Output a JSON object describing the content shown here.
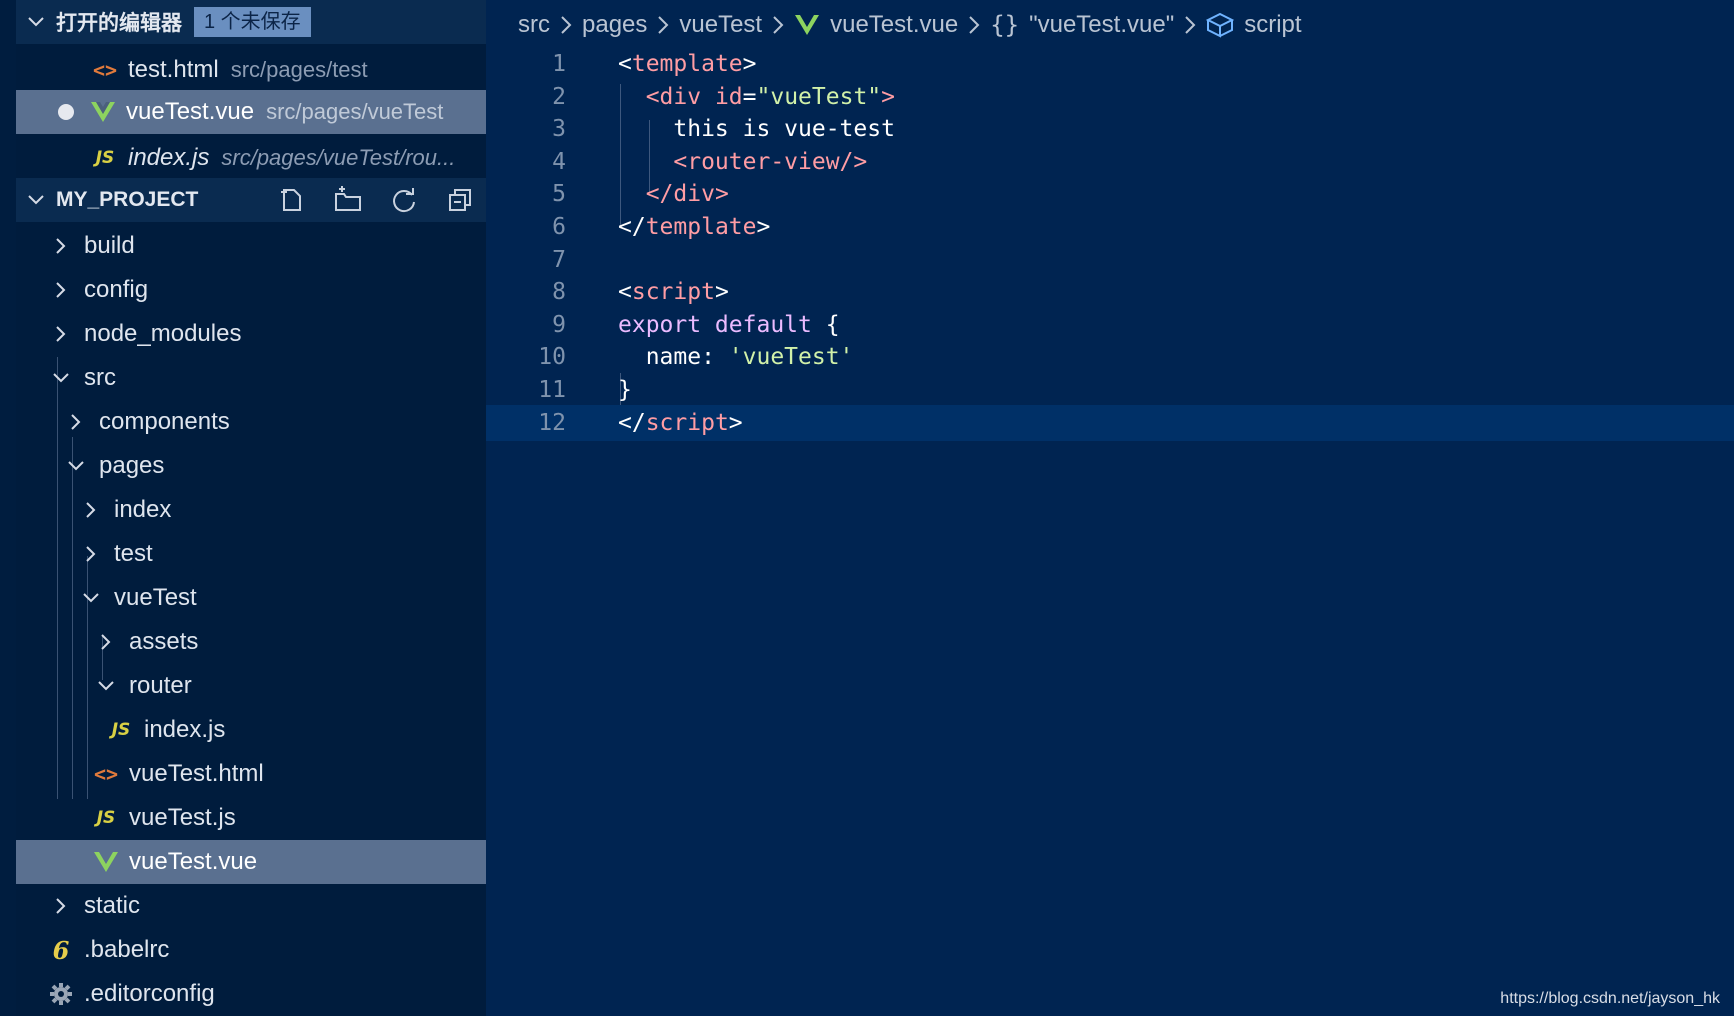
{
  "open_editors": {
    "title": "打开的编辑器",
    "unsaved_badge": "1 个未保存",
    "items": [
      {
        "name": "test.html",
        "path": "src/pages/test",
        "icon": "html-icon"
      },
      {
        "name": "vueTest.vue",
        "path": "src/pages/vueTest",
        "icon": "vue-icon",
        "dirty": true
      },
      {
        "name": "index.js",
        "path": "src/pages/vueTest/rou...",
        "icon": "js-icon"
      }
    ]
  },
  "explorer": {
    "title": "MY_PROJECT",
    "tools": [
      "new-file-icon",
      "new-folder-icon",
      "refresh-icon",
      "collapse-all-icon"
    ],
    "tree": [
      {
        "label": "build",
        "type": "folder",
        "expanded": false
      },
      {
        "label": "config",
        "type": "folder",
        "expanded": false
      },
      {
        "label": "node_modules",
        "type": "folder",
        "expanded": false
      },
      {
        "label": "src",
        "type": "folder",
        "expanded": true
      },
      {
        "label": "components",
        "type": "folder",
        "expanded": false
      },
      {
        "label": "pages",
        "type": "folder",
        "expanded": true
      },
      {
        "label": "index",
        "type": "folder",
        "expanded": false
      },
      {
        "label": "test",
        "type": "folder",
        "expanded": false
      },
      {
        "label": "vueTest",
        "type": "folder",
        "expanded": true
      },
      {
        "label": "assets",
        "type": "folder",
        "expanded": false
      },
      {
        "label": "router",
        "type": "folder",
        "expanded": true
      },
      {
        "label": "index.js",
        "type": "js"
      },
      {
        "label": "vueTest.html",
        "type": "html"
      },
      {
        "label": "vueTest.js",
        "type": "js"
      },
      {
        "label": "vueTest.vue",
        "type": "vue",
        "selected": true
      },
      {
        "label": "static",
        "type": "folder",
        "expanded": false
      },
      {
        "label": ".babelrc",
        "type": "babel"
      },
      {
        "label": ".editorconfig",
        "type": "config"
      }
    ]
  },
  "breadcrumb": {
    "items": [
      "src",
      "pages",
      "vueTest",
      "vueTest.vue",
      "\"vueTest.vue\"",
      "script"
    ],
    "braces": "{}"
  },
  "code": {
    "lines": [
      {
        "n": "1",
        "tokens": [
          [
            "t-punc",
            "<"
          ],
          [
            "t-tag",
            "template"
          ],
          [
            "t-punc",
            ">"
          ]
        ]
      },
      {
        "n": "2",
        "tokens": [
          [
            "t-txt",
            "  "
          ],
          [
            "t-tag",
            "<div "
          ],
          [
            "t-attr",
            "id"
          ],
          [
            "t-punc",
            "="
          ],
          [
            "t-str",
            "\"vueTest\""
          ],
          [
            "t-tag",
            ">"
          ]
        ]
      },
      {
        "n": "3",
        "tokens": [
          [
            "t-txt",
            "    this is vue-test"
          ]
        ]
      },
      {
        "n": "4",
        "tokens": [
          [
            "t-txt",
            "    "
          ],
          [
            "t-tag",
            "<router-view/>"
          ]
        ]
      },
      {
        "n": "5",
        "tokens": [
          [
            "t-txt",
            "  "
          ],
          [
            "t-tag",
            "</div>"
          ]
        ]
      },
      {
        "n": "6",
        "tokens": [
          [
            "t-punc",
            "</"
          ],
          [
            "t-tag",
            "template"
          ],
          [
            "t-punc",
            ">"
          ]
        ]
      },
      {
        "n": "7",
        "tokens": []
      },
      {
        "n": "8",
        "tokens": [
          [
            "t-punc",
            "<"
          ],
          [
            "t-tag",
            "script"
          ],
          [
            "t-punc",
            ">"
          ]
        ]
      },
      {
        "n": "9",
        "tokens": [
          [
            "t-kw",
            "export default "
          ],
          [
            "t-punc",
            "{"
          ]
        ]
      },
      {
        "n": "10",
        "tokens": [
          [
            "t-txt",
            "  name: "
          ],
          [
            "t-str",
            "'vueTest'"
          ]
        ]
      },
      {
        "n": "11",
        "tokens": [
          [
            "t-punc",
            "}"
          ]
        ]
      },
      {
        "n": "12",
        "tokens": [
          [
            "t-punc",
            "</"
          ],
          [
            "t-tag",
            "script"
          ],
          [
            "t-punc",
            ">"
          ]
        ],
        "current": true
      }
    ]
  },
  "watermark": "https://blog.csdn.net/jayson_hk",
  "colors": {
    "sidebar_bg": "#001c3d",
    "editor_bg": "#002451",
    "selection": "#5a7090",
    "vue_green": "#8dd35f",
    "js_yellow": "#d8d044",
    "html_orange": "#e07a3c"
  }
}
